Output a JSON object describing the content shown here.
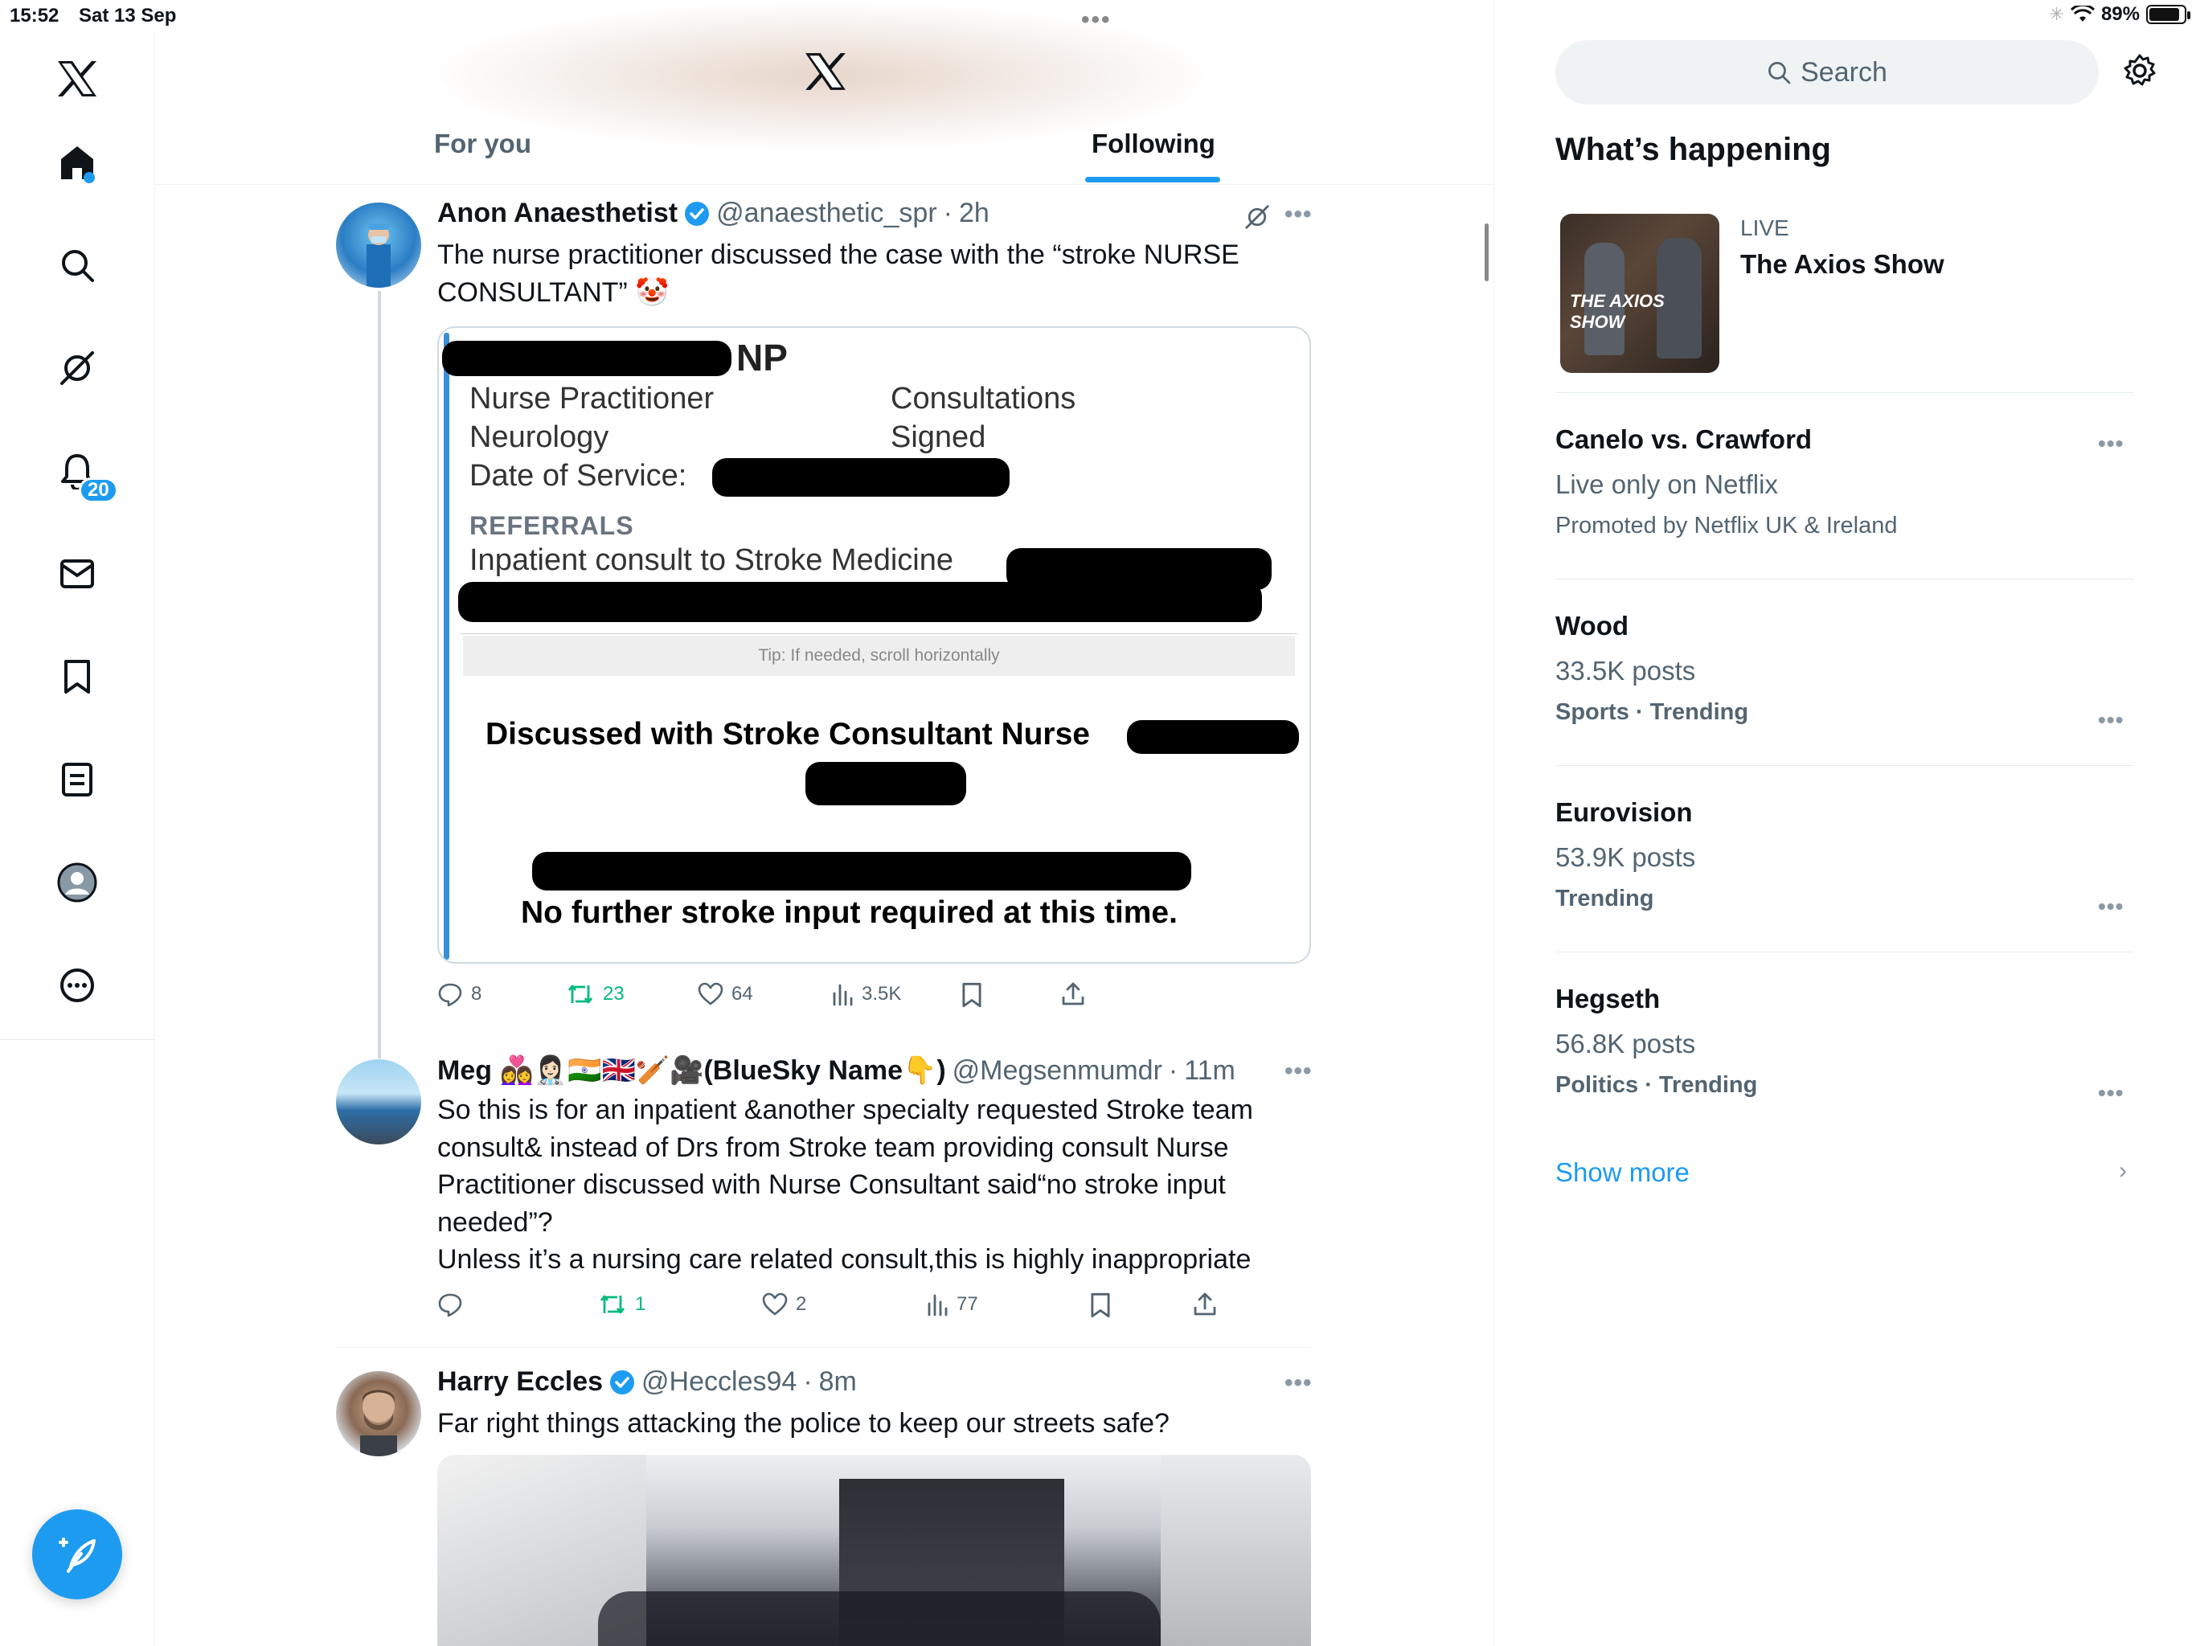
{
  "status_bar": {
    "time": "15:52",
    "date": "Sat 13 Sep",
    "battery": "89%",
    "battery_level": 0.89
  },
  "nav": {
    "items": [
      "home-icon",
      "search-icon",
      "grok-icon",
      "bell-icon",
      "mail-icon",
      "bookmark-icon",
      "lists-icon",
      "profile-icon",
      "more-icon"
    ],
    "notification_count": "20"
  },
  "header": {
    "tabs": [
      {
        "label": "For you"
      },
      {
        "label": "Following"
      }
    ],
    "active_tab": "Following"
  },
  "tweets": [
    {
      "name": "Anon Anaesthetist",
      "verified": true,
      "handle": "@anaesthetic_spr",
      "time": "2h",
      "text": "The nurse practitioner discussed the case with the “stroke NURSE CONSULTANT” 🤡",
      "media": {
        "np": "NP",
        "left_lines": [
          "Nurse Practitioner",
          "Neurology",
          "Date of Service:"
        ],
        "right_lines": [
          "Consultations",
          "Signed"
        ],
        "section": "REFERRALS",
        "referral": "Inpatient consult to Stroke Medicine",
        "tip": "Tip: If needed, scroll horizontally",
        "discussed": "Discussed with Stroke Consultant Nurse",
        "conclusion": "No further stroke input required at this time."
      },
      "replies": "8",
      "retweets": "23",
      "likes": "64",
      "views": "3.5K"
    },
    {
      "name": "Meg 👩‍❤️‍👩👩🏻‍⚕️🇮🇳🇬🇧🏏🎥(BlueSky Name👇)",
      "verified": false,
      "handle": "@Megsenmumdr",
      "time": "11m",
      "text": "So this is for an inpatient &another specialty requested Stroke team consult& instead of Drs from Stroke team providing consult Nurse Practitioner discussed with Nurse Consultant said“no stroke input needed”?\nUnless it’s a nursing care related consult,this is highly inappropriate",
      "replies": "",
      "retweets": "1",
      "likes": "2",
      "views": "77"
    },
    {
      "name": "Harry Eccles",
      "verified": true,
      "handle": "@Heccles94",
      "time": "8m",
      "text": "Far right things attacking the police to keep our streets safe?"
    }
  ],
  "sidebar": {
    "search_placeholder": "Search",
    "heading": "What’s happening",
    "live": {
      "label": "LIVE",
      "title": "The Axios Show",
      "thumb_text": "THE AXIOS SHOW"
    },
    "trends": [
      {
        "title": "Canelo vs. Crawford",
        "sub": "Live only on Netflix",
        "cat": "Promoted by Netflix UK & Ireland"
      },
      {
        "title": "Wood",
        "sub": "33.5K posts",
        "cat": "Sports · Trending"
      },
      {
        "title": "Eurovision",
        "sub": "53.9K posts",
        "cat": "Trending"
      },
      {
        "title": "Hegseth",
        "sub": "56.8K posts",
        "cat": "Politics · Trending"
      }
    ],
    "show_more": "Show more"
  },
  "colors": {
    "accent": "#1d9bf0",
    "retweet": "#00ba7c",
    "muted": "#536471"
  }
}
